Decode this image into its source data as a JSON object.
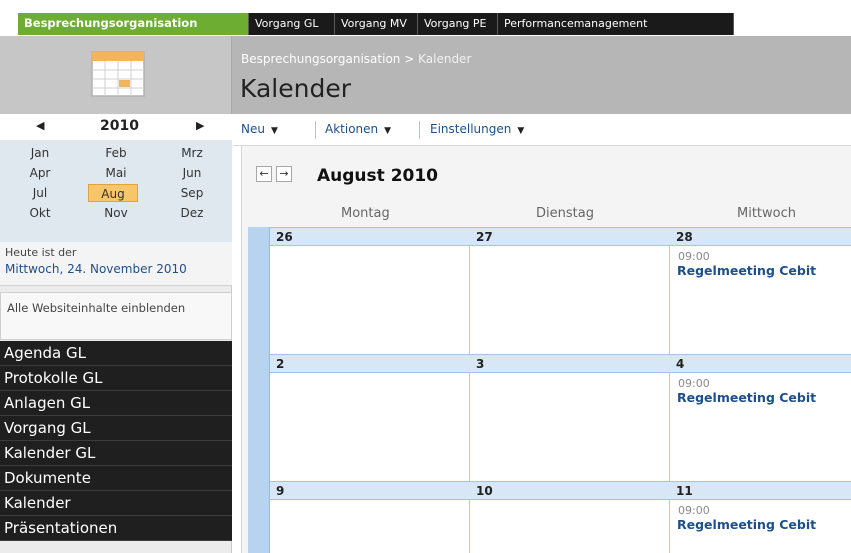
{
  "topnav": {
    "tabs": [
      {
        "label": "Besprechungsorganisation",
        "active": true
      },
      {
        "label": "Vorgang GL",
        "active": false
      },
      {
        "label": "Vorgang MV",
        "active": false
      },
      {
        "label": "Vorgang PE",
        "active": false
      },
      {
        "label": "Performancemanagement",
        "active": false
      }
    ]
  },
  "header": {
    "breadcrumb_parent": "Besprechungsorganisation",
    "breadcrumb_separator": ">",
    "breadcrumb_current": "Kalender",
    "title": "Kalender"
  },
  "datepicker": {
    "prev": "◀",
    "year": "2010",
    "next": "▶",
    "months": [
      "Jan",
      "Feb",
      "Mrz",
      "Apr",
      "Mai",
      "Jun",
      "Jul",
      "Aug",
      "Sep",
      "Okt",
      "Nov",
      "Dez"
    ],
    "selected_month": "Aug"
  },
  "today": {
    "line1": "Heute ist der",
    "line2": "Mittwoch, 24. November 2010"
  },
  "all_site_content": "Alle Websiteinhalte einblenden",
  "quicklaunch": [
    "Agenda GL",
    "Protokolle GL",
    "Anlagen GL",
    "Vorgang GL",
    "Kalender GL",
    "Dokumente",
    "Kalender",
    "Präsentationen"
  ],
  "toolbar": {
    "new_label": "Neu",
    "actions_label": "Aktionen",
    "settings_label": "Einstellungen",
    "dropdown_glyph": "▼"
  },
  "calendar": {
    "prev_btn": "←",
    "next_btn": "→",
    "month_title": "August 2010",
    "day_names": [
      "Montag",
      "Dienstag",
      "Mittwoch"
    ],
    "weeks": [
      {
        "days": [
          "26",
          "27",
          "28"
        ]
      },
      {
        "days": [
          "2",
          "3",
          "4"
        ]
      },
      {
        "days": [
          "9",
          "10",
          "11"
        ]
      }
    ],
    "event": {
      "time": "09:00",
      "title": "Regelmeeting Cebit"
    }
  },
  "colors": {
    "active_tab": "#6cad32",
    "nav_dark": "#1f1f1f",
    "link_blue": "#1d4f8a",
    "week_header": "#d7e7f6"
  }
}
